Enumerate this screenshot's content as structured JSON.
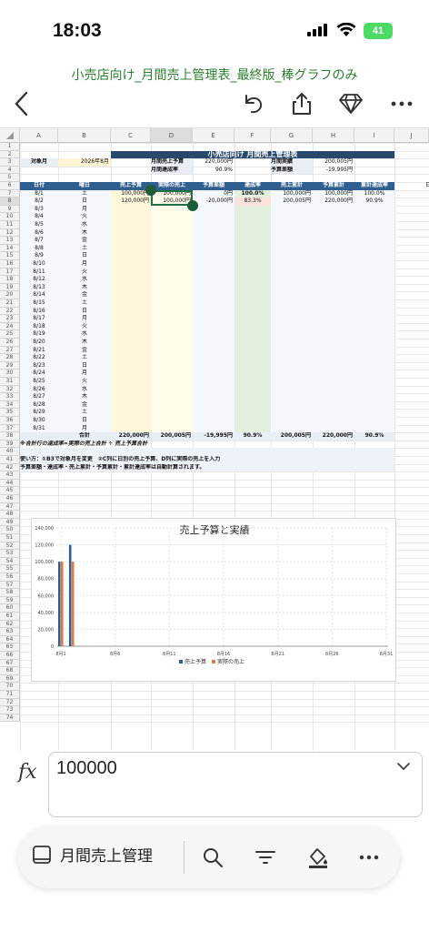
{
  "status": {
    "time": "18:03",
    "battery": "41"
  },
  "document": {
    "title": "小売店向け_月間売上管理表_最終版_棒グラフのみ"
  },
  "toolbar": {
    "back": "back-icon",
    "undo": "undo-icon",
    "share": "share-icon",
    "premium": "diamond-icon",
    "more": "more-icon"
  },
  "sheet": {
    "columns": [
      "A",
      "B",
      "C",
      "D",
      "E",
      "F",
      "G",
      "H",
      "I",
      "J"
    ],
    "selected_column": "D",
    "rows": [
      "1",
      "2",
      "3",
      "4",
      "5",
      "6",
      "7",
      "8",
      "9",
      "10",
      "11",
      "12",
      "13",
      "14",
      "15",
      "16",
      "17",
      "18",
      "19",
      "20",
      "21",
      "22",
      "23",
      "24",
      "25",
      "26",
      "27",
      "28",
      "29",
      "30",
      "31",
      "32",
      "33",
      "34",
      "35",
      "36",
      "37",
      "38",
      "39",
      "40",
      "41",
      "42",
      "43",
      "44",
      "45",
      "46",
      "47",
      "48",
      "49",
      "50",
      "51",
      "52",
      "53",
      "54",
      "55",
      "56",
      "57",
      "58",
      "59",
      "60",
      "61",
      "62",
      "63",
      "64",
      "65",
      "66",
      "67",
      "68",
      "69",
      "70",
      "71",
      "72",
      "73",
      "74"
    ],
    "title": "小売店向け 月間売上管理表",
    "target_month_label": "対象月",
    "target_month_value": "2026年8月",
    "monthly_budget_label": "月間売上予算",
    "monthly_budget_value": "220,000円",
    "monthly_rate_label": "月間達成率",
    "monthly_rate_value": "90.9%",
    "monthly_actual_label": "月間実績",
    "monthly_actual_value": "200,005円",
    "budget_diff_label": "予算差額",
    "budget_diff_value": "-19,995円",
    "headers": [
      "日付",
      "曜日",
      "売上予算",
      "実際の売上",
      "予算差額",
      "達成率",
      "売上累計",
      "予算累計",
      "累計達成率"
    ],
    "side_label": "日",
    "days": [
      {
        "date": "8/1",
        "dow": "土",
        "budget": "100,000円",
        "actual": "100,000円",
        "diff": "0円",
        "rate": "100.0%",
        "cum": "100,000円",
        "cumbudget": "100,000円",
        "cumrate": "100.0%"
      },
      {
        "date": "8/2",
        "dow": "日",
        "budget": "120,000円",
        "actual": "100,000円",
        "diff": "-20,000円",
        "rate": "83.3%",
        "cum": "200,005円",
        "cumbudget": "220,000円",
        "cumrate": "90.9%"
      },
      {
        "date": "8/3",
        "dow": "月"
      },
      {
        "date": "8/4",
        "dow": "火"
      },
      {
        "date": "8/5",
        "dow": "水"
      },
      {
        "date": "8/6",
        "dow": "木"
      },
      {
        "date": "8/7",
        "dow": "金"
      },
      {
        "date": "8/8",
        "dow": "土"
      },
      {
        "date": "8/9",
        "dow": "日"
      },
      {
        "date": "8/10",
        "dow": "月"
      },
      {
        "date": "8/11",
        "dow": "火"
      },
      {
        "date": "8/12",
        "dow": "水"
      },
      {
        "date": "8/13",
        "dow": "木"
      },
      {
        "date": "8/14",
        "dow": "金"
      },
      {
        "date": "8/15",
        "dow": "土"
      },
      {
        "date": "8/16",
        "dow": "日"
      },
      {
        "date": "8/17",
        "dow": "月"
      },
      {
        "date": "8/18",
        "dow": "火"
      },
      {
        "date": "8/19",
        "dow": "水"
      },
      {
        "date": "8/20",
        "dow": "木"
      },
      {
        "date": "8/21",
        "dow": "金"
      },
      {
        "date": "8/22",
        "dow": "土"
      },
      {
        "date": "8/23",
        "dow": "日"
      },
      {
        "date": "8/24",
        "dow": "月"
      },
      {
        "date": "8/25",
        "dow": "火"
      },
      {
        "date": "8/26",
        "dow": "水"
      },
      {
        "date": "8/27",
        "dow": "木"
      },
      {
        "date": "8/28",
        "dow": "金"
      },
      {
        "date": "8/29",
        "dow": "土"
      },
      {
        "date": "8/30",
        "dow": "日"
      },
      {
        "date": "8/31",
        "dow": "月"
      }
    ],
    "total_label": "合計",
    "total_budget": "220,000円",
    "total_actual": "200,005円",
    "total_diff": "-19,995円",
    "total_rate": "90.9%",
    "total_cum": "200,005円",
    "total_cumbudget": "220,000円",
    "total_cumrate": "90.9%",
    "note": "※合計行の達成率=実際の売上合計 ÷ 売上予算合計",
    "howto_1": "使い方：①B3で対象月を変更　②C列に日別の売上予算、D列に実際の売上を入力",
    "howto_2": "予算差額・達成率・売上累計・予算累計・累計達成率は自動計算されます。"
  },
  "chart_data": {
    "type": "bar",
    "title": "売上予算と実績",
    "x_tick_labels": [
      "8月1",
      "8月6",
      "8月11",
      "8月16",
      "8月21",
      "8月26",
      "8月31"
    ],
    "y_tick_labels": [
      "0",
      "20,000",
      "40,000",
      "60,000",
      "80,000",
      "100,000",
      "120,000",
      "140,000"
    ],
    "categories": [
      "8/1",
      "8/2"
    ],
    "series": [
      {
        "name": "売上予算",
        "values": [
          100000,
          120000
        ],
        "color": "#2f5f8f"
      },
      {
        "name": "実際の売上",
        "values": [
          100000,
          100000
        ],
        "color": "#e07a3f"
      }
    ],
    "ylim": [
      0,
      140000
    ],
    "legend_position": "bottom",
    "grid": true
  },
  "formula": {
    "value": "100000"
  },
  "bottom": {
    "sheet_name": "月間売上管理"
  }
}
